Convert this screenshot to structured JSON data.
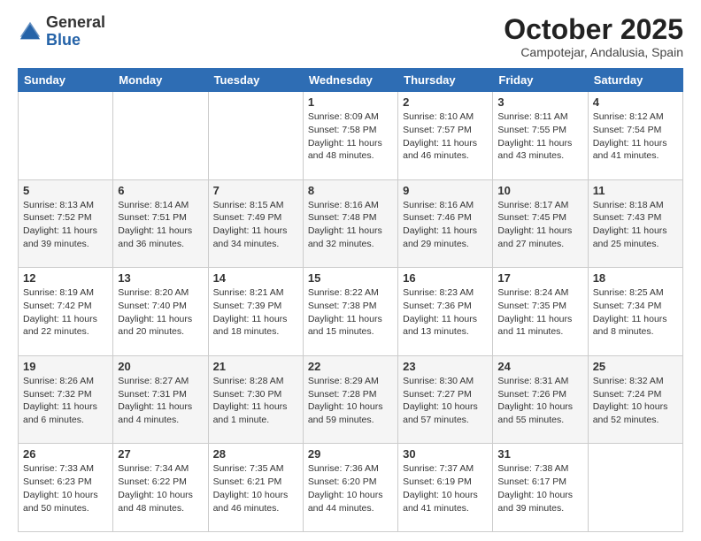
{
  "logo": {
    "general": "General",
    "blue": "Blue"
  },
  "header": {
    "month": "October 2025",
    "location": "Campotejar, Andalusia, Spain"
  },
  "weekdays": [
    "Sunday",
    "Monday",
    "Tuesday",
    "Wednesday",
    "Thursday",
    "Friday",
    "Saturday"
  ],
  "weeks": [
    [
      {
        "day": "",
        "info": ""
      },
      {
        "day": "",
        "info": ""
      },
      {
        "day": "",
        "info": ""
      },
      {
        "day": "1",
        "info": "Sunrise: 8:09 AM\nSunset: 7:58 PM\nDaylight: 11 hours and 48 minutes."
      },
      {
        "day": "2",
        "info": "Sunrise: 8:10 AM\nSunset: 7:57 PM\nDaylight: 11 hours and 46 minutes."
      },
      {
        "day": "3",
        "info": "Sunrise: 8:11 AM\nSunset: 7:55 PM\nDaylight: 11 hours and 43 minutes."
      },
      {
        "day": "4",
        "info": "Sunrise: 8:12 AM\nSunset: 7:54 PM\nDaylight: 11 hours and 41 minutes."
      }
    ],
    [
      {
        "day": "5",
        "info": "Sunrise: 8:13 AM\nSunset: 7:52 PM\nDaylight: 11 hours and 39 minutes."
      },
      {
        "day": "6",
        "info": "Sunrise: 8:14 AM\nSunset: 7:51 PM\nDaylight: 11 hours and 36 minutes."
      },
      {
        "day": "7",
        "info": "Sunrise: 8:15 AM\nSunset: 7:49 PM\nDaylight: 11 hours and 34 minutes."
      },
      {
        "day": "8",
        "info": "Sunrise: 8:16 AM\nSunset: 7:48 PM\nDaylight: 11 hours and 32 minutes."
      },
      {
        "day": "9",
        "info": "Sunrise: 8:16 AM\nSunset: 7:46 PM\nDaylight: 11 hours and 29 minutes."
      },
      {
        "day": "10",
        "info": "Sunrise: 8:17 AM\nSunset: 7:45 PM\nDaylight: 11 hours and 27 minutes."
      },
      {
        "day": "11",
        "info": "Sunrise: 8:18 AM\nSunset: 7:43 PM\nDaylight: 11 hours and 25 minutes."
      }
    ],
    [
      {
        "day": "12",
        "info": "Sunrise: 8:19 AM\nSunset: 7:42 PM\nDaylight: 11 hours and 22 minutes."
      },
      {
        "day": "13",
        "info": "Sunrise: 8:20 AM\nSunset: 7:40 PM\nDaylight: 11 hours and 20 minutes."
      },
      {
        "day": "14",
        "info": "Sunrise: 8:21 AM\nSunset: 7:39 PM\nDaylight: 11 hours and 18 minutes."
      },
      {
        "day": "15",
        "info": "Sunrise: 8:22 AM\nSunset: 7:38 PM\nDaylight: 11 hours and 15 minutes."
      },
      {
        "day": "16",
        "info": "Sunrise: 8:23 AM\nSunset: 7:36 PM\nDaylight: 11 hours and 13 minutes."
      },
      {
        "day": "17",
        "info": "Sunrise: 8:24 AM\nSunset: 7:35 PM\nDaylight: 11 hours and 11 minutes."
      },
      {
        "day": "18",
        "info": "Sunrise: 8:25 AM\nSunset: 7:34 PM\nDaylight: 11 hours and 8 minutes."
      }
    ],
    [
      {
        "day": "19",
        "info": "Sunrise: 8:26 AM\nSunset: 7:32 PM\nDaylight: 11 hours and 6 minutes."
      },
      {
        "day": "20",
        "info": "Sunrise: 8:27 AM\nSunset: 7:31 PM\nDaylight: 11 hours and 4 minutes."
      },
      {
        "day": "21",
        "info": "Sunrise: 8:28 AM\nSunset: 7:30 PM\nDaylight: 11 hours and 1 minute."
      },
      {
        "day": "22",
        "info": "Sunrise: 8:29 AM\nSunset: 7:28 PM\nDaylight: 10 hours and 59 minutes."
      },
      {
        "day": "23",
        "info": "Sunrise: 8:30 AM\nSunset: 7:27 PM\nDaylight: 10 hours and 57 minutes."
      },
      {
        "day": "24",
        "info": "Sunrise: 8:31 AM\nSunset: 7:26 PM\nDaylight: 10 hours and 55 minutes."
      },
      {
        "day": "25",
        "info": "Sunrise: 8:32 AM\nSunset: 7:24 PM\nDaylight: 10 hours and 52 minutes."
      }
    ],
    [
      {
        "day": "26",
        "info": "Sunrise: 7:33 AM\nSunset: 6:23 PM\nDaylight: 10 hours and 50 minutes."
      },
      {
        "day": "27",
        "info": "Sunrise: 7:34 AM\nSunset: 6:22 PM\nDaylight: 10 hours and 48 minutes."
      },
      {
        "day": "28",
        "info": "Sunrise: 7:35 AM\nSunset: 6:21 PM\nDaylight: 10 hours and 46 minutes."
      },
      {
        "day": "29",
        "info": "Sunrise: 7:36 AM\nSunset: 6:20 PM\nDaylight: 10 hours and 44 minutes."
      },
      {
        "day": "30",
        "info": "Sunrise: 7:37 AM\nSunset: 6:19 PM\nDaylight: 10 hours and 41 minutes."
      },
      {
        "day": "31",
        "info": "Sunrise: 7:38 AM\nSunset: 6:17 PM\nDaylight: 10 hours and 39 minutes."
      },
      {
        "day": "",
        "info": ""
      }
    ]
  ]
}
